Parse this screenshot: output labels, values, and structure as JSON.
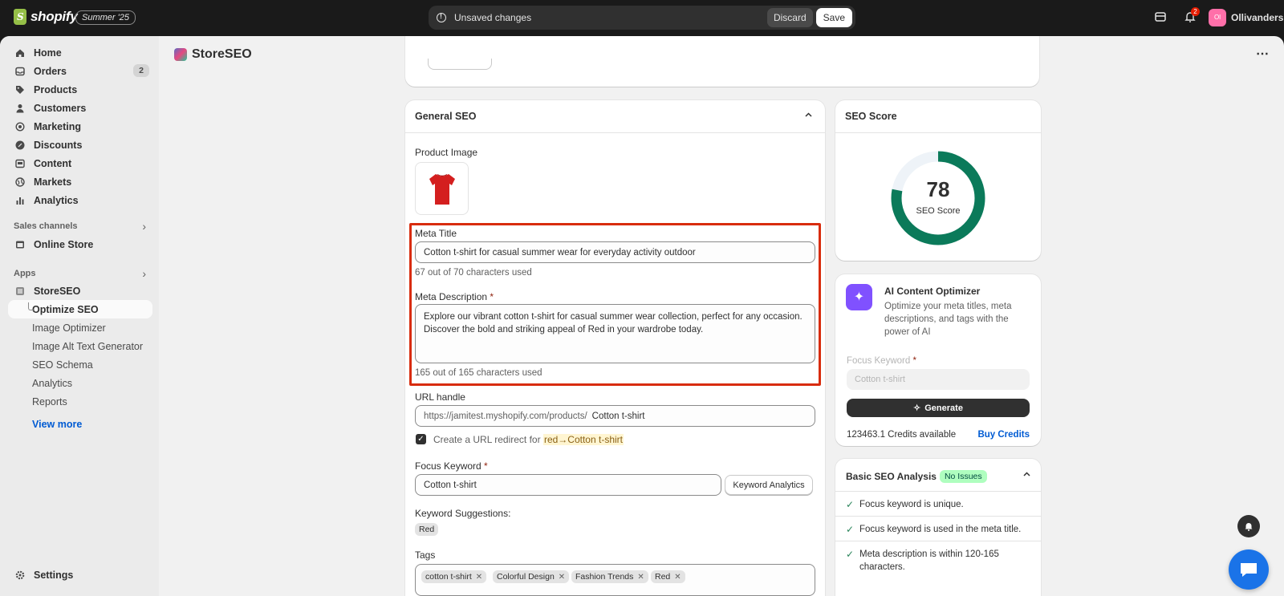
{
  "topbar": {
    "brand": "shopify",
    "edition": "Summer '25",
    "unsaved_text": "Unsaved changes",
    "discard_label": "Discard",
    "save_label": "Save",
    "notification_count": "2",
    "store_initials": "Ol",
    "store_name": "Ollivanders",
    "icons": [
      "info-icon",
      "store-switcher-icon",
      "bell-icon"
    ]
  },
  "sidebar": {
    "items": [
      {
        "label": "Home",
        "icon": "home-icon"
      },
      {
        "label": "Orders",
        "icon": "inbox-icon",
        "badge": "2"
      },
      {
        "label": "Products",
        "icon": "tag-icon"
      },
      {
        "label": "Customers",
        "icon": "person-icon"
      },
      {
        "label": "Marketing",
        "icon": "target-icon"
      },
      {
        "label": "Discounts",
        "icon": "discount-icon"
      },
      {
        "label": "Content",
        "icon": "content-icon"
      },
      {
        "label": "Markets",
        "icon": "globe-icon"
      },
      {
        "label": "Analytics",
        "icon": "chart-icon"
      }
    ],
    "sales_channels_label": "Sales channels",
    "online_store_label": "Online Store",
    "apps_label": "Apps",
    "app_name": "StoreSEO",
    "app_subitems": [
      "Optimize SEO",
      "Image Optimizer",
      "Image Alt Text Generator",
      "SEO Schema",
      "Analytics",
      "Reports"
    ],
    "view_more": "View more",
    "settings_label": "Settings"
  },
  "app_header": {
    "title": "StoreSEO"
  },
  "general_seo": {
    "title": "General SEO",
    "product_image_label": "Product Image",
    "meta_title_label": "Meta Title",
    "meta_title_value": "Cotton t-shirt for casual summer wear for everyday activity outdoor",
    "meta_title_help": "67 out of 70 characters used",
    "meta_desc_label": "Meta Description",
    "required_mark": "*",
    "meta_desc_value": "Explore our vibrant cotton t-shirt for casual summer wear collection, perfect for any occasion. Discover the bold and striking appeal of Red in your wardrobe today.",
    "meta_desc_help": "165 out of 165 characters used",
    "url_label": "URL handle",
    "url_prefix": "https://jamitest.myshopify.com/products/",
    "url_value": "Cotton t-shirt",
    "redirect_text": "Create a URL redirect for",
    "redirect_target": "red→Cotton t-shirt",
    "focus_label": "Focus Keyword",
    "focus_value": "Cotton t-shirt",
    "keyword_analytics": "Keyword Analytics",
    "suggestions_label": "Keyword Suggestions:",
    "suggestion": "Red",
    "tags_label": "Tags",
    "tags": [
      "cotton t-shirt",
      "Colorful Design",
      "Fashion Trends",
      "Red"
    ]
  },
  "seo_score": {
    "title": "SEO Score",
    "score": "78",
    "score_value": 78,
    "caption": "SEO Score",
    "ring_color": "#0b7a5a",
    "track_color": "#eef3f8"
  },
  "ai_optimizer": {
    "title": "AI Content Optimizer",
    "description": "Optimize your meta titles, meta descriptions, and tags with the power of AI",
    "focus_label": "Focus Keyword",
    "required_mark": "*",
    "placeholder": "Cotton t-shirt",
    "generate_label": "Generate",
    "credits": "123463.1 Credits available",
    "buy_label": "Buy Credits"
  },
  "basic_analysis": {
    "title": "Basic SEO Analysis",
    "badge": "No Issues",
    "checks": [
      "Focus keyword is unique.",
      "Focus keyword is used in the meta title.",
      "Meta description is within 120-165 characters."
    ]
  },
  "colors": {
    "accent_blue": "#005bd3",
    "highlight_red": "#d82c0d",
    "success_green": "#29845a",
    "ai_purple": "#8051ff"
  }
}
